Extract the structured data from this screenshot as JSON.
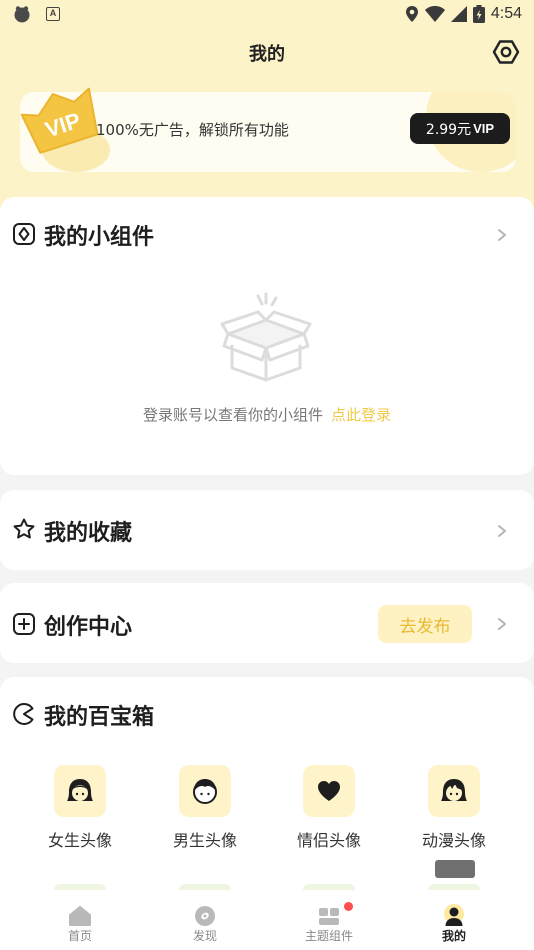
{
  "status_bar": {
    "time": "4:54",
    "keyboard_indicator": "A"
  },
  "header": {
    "title": "我的"
  },
  "vip": {
    "badge": "VIP",
    "text": "100%无广告，解锁所有功能",
    "price": "2.99元",
    "price_suffix": "VIP"
  },
  "widgets": {
    "title": "我的小组件",
    "empty_text": "登录账号以查看你的小组件",
    "login_link": "点此登录"
  },
  "favorites": {
    "title": "我的收藏"
  },
  "create": {
    "title": "创作中心",
    "publish_label": "去发布"
  },
  "toolbox": {
    "title": "我的百宝箱",
    "items": [
      {
        "label": "女生头像",
        "icon": "girl-avatar-icon"
      },
      {
        "label": "男生头像",
        "icon": "boy-avatar-icon"
      },
      {
        "label": "情侣头像",
        "icon": "heart-icon"
      },
      {
        "label": "动漫头像",
        "icon": "anime-avatar-icon"
      }
    ]
  },
  "bottom_nav": {
    "items": [
      {
        "label": "首页",
        "icon": "home-icon",
        "active": false
      },
      {
        "label": "发现",
        "icon": "discover-icon",
        "active": false
      },
      {
        "label": "主题组件",
        "icon": "theme-widgets-icon",
        "active": false,
        "badge": true
      },
      {
        "label": "我的",
        "icon": "profile-icon",
        "active": true
      }
    ]
  },
  "colors": {
    "header_bg": "#fdf3c9",
    "accent_yellow": "#f3c94a",
    "price_button_bg": "#1c1c1c",
    "badge_red": "#ff4d4f"
  }
}
